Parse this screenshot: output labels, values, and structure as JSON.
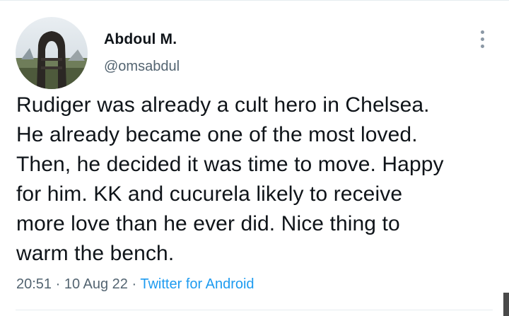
{
  "author": {
    "display_name": "Abdoul M.",
    "handle": "@omsabdul"
  },
  "tweet": {
    "lines": [
      "Rudiger was already a cult hero in Chelsea.",
      "He already became one of the most loved.",
      "Then, he decided it was time to move. Happy",
      "for him. KK and cucurela likely to receive",
      "more love than he ever did. Nice thing to",
      "warm the bench."
    ],
    "time": "20:51",
    "separator1": " · ",
    "date": "10 Aug 22",
    "separator2": " · ",
    "source": "Twitter for Android"
  },
  "colors": {
    "text": "#0f1419",
    "secondary": "#536471",
    "link": "#1d9bf0"
  },
  "icons": {
    "more": "more-options-icon"
  }
}
